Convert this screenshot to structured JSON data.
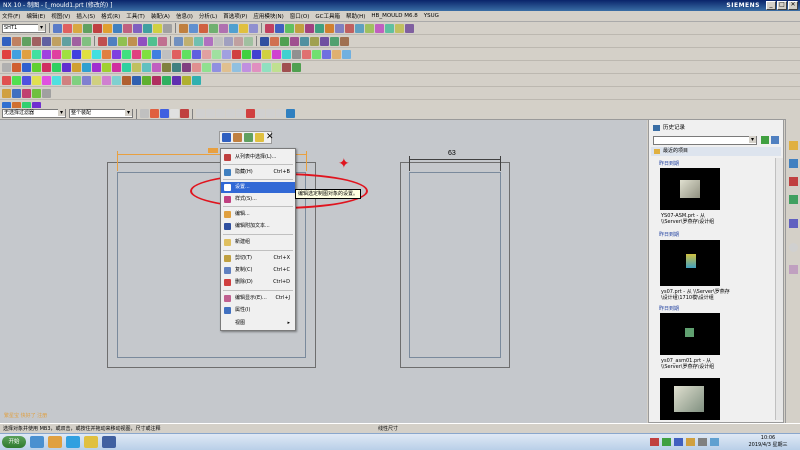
{
  "window": {
    "title": "NX 10 - 制图 - [_mould1.prt  (修改的) ]",
    "brand": "SIEMENS",
    "controls": [
      "_",
      "□",
      "✕"
    ]
  },
  "menubar": [
    "文件(F)",
    "编辑(E)",
    "视图(V)",
    "插入(S)",
    "格式(R)",
    "工具(T)",
    "装配(A)",
    "信息(I)",
    "分析(L)",
    "首选项(P)",
    "应用模块(N)",
    "窗口(O)",
    "GC工具箱",
    "帮助(H)",
    "HB_MOULD M6.8",
    "YSUG"
  ],
  "toolbar": {
    "sheet_combo": "SHT1",
    "filter_combo": "无选择过滤器",
    "assembly_combo": "整个装配"
  },
  "drawing": {
    "dimension_value": "63"
  },
  "context_menu": {
    "items": [
      {
        "label": "从列表中选择(L)...",
        "shortcut": ""
      },
      {
        "label": "隐藏(H)",
        "shortcut": "Ctrl+B"
      },
      {
        "label": "设置...",
        "shortcut": ""
      },
      {
        "label": "样式(S)...",
        "shortcut": ""
      },
      {
        "label": "编辑...",
        "shortcut": ""
      },
      {
        "label": "编辑附加文本...",
        "shortcut": ""
      },
      {
        "label": "新建组",
        "shortcut": ""
      },
      {
        "label": "剪切(T)",
        "shortcut": "Ctrl+X"
      },
      {
        "label": "复制(C)",
        "shortcut": "Ctrl+C"
      },
      {
        "label": "删除(D)",
        "shortcut": "Ctrl+D"
      },
      {
        "label": "编辑显示(E)...",
        "shortcut": "Ctrl+J"
      },
      {
        "label": "属性(I)",
        "shortcut": ""
      },
      {
        "label": "视图",
        "shortcut": "▸"
      }
    ],
    "tooltip": "编辑选定制图对象的设置。"
  },
  "history_panel": {
    "title": "历史记录",
    "recent_label": "最近的项目",
    "groups": [
      "昨日到期",
      "昨日到期",
      "昨日到期"
    ],
    "items": [
      {
        "caption": "YS07-ASM.prt - 从 \\\\Server\\罗燕存\\设计组"
      },
      {
        "caption": "ys07.prt - 从 \\\\Server\\罗燕存\\设计组\\1710模\\设计组"
      },
      {
        "caption": "ys07_asm01.prt - 从 \\\\Server\\罗燕存\\设计组"
      },
      {
        "caption": ""
      }
    ]
  },
  "status": {
    "prompt": "选择对象并使用 MB3，或双击，或按住并拖动来移动视图，尺寸或注释",
    "center_text": "线性尺寸",
    "watermark": "繁星宝 快好了 注册"
  },
  "taskbar": {
    "start_label": "开始",
    "clock_time": "10:06",
    "clock_date": "2019/4/3 星期三"
  },
  "colors": {
    "highlight": "#3168d5",
    "red_annotation": "#e0141e",
    "dimension_orange": "#e8a040"
  }
}
